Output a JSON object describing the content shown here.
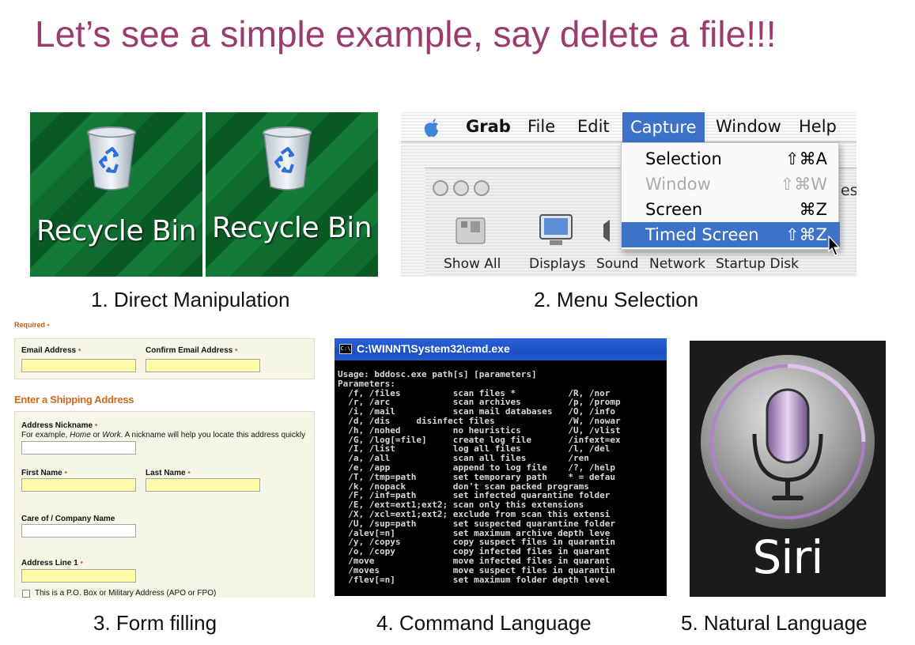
{
  "title": "Let’s see a simple example, say delete a file!!!",
  "captions": {
    "c1": "1. Direct Manipulation",
    "c2": "2. Menu Selection",
    "c3": "3. Form filling",
    "c4": "4. Command Language",
    "c5": "5. Natural Language"
  },
  "recycle": {
    "label": "Recycle Bin",
    "icon": "recycle-bin-icon",
    "bg_color": "#0f6b2f"
  },
  "mac": {
    "menus": [
      "Grab",
      "File",
      "Edit",
      "Capture",
      "Window",
      "Help"
    ],
    "active_menu": "Capture",
    "accent": "#3c73c9",
    "dropdown": [
      {
        "label": "Selection",
        "shortcut": "⇧⌘A"
      },
      {
        "label": "Window",
        "shortcut": "⇧⌘W"
      },
      {
        "label": "Screen",
        "shortcut": "⌘Z"
      },
      {
        "label": "Timed Screen",
        "shortcut": "⇧⌘Z"
      }
    ],
    "prefs": [
      "Show All",
      "Displays",
      "Sound",
      "Network",
      "Startup Disk"
    ],
    "partial": "es"
  },
  "form": {
    "required": "Required",
    "email": "Email Address",
    "confirm_email": "Confirm Email Address",
    "ship_heading": "Enter a Shipping Address",
    "nickname": "Address Nickname",
    "nickname_help_1": "For example, ",
    "nickname_help_home": "Home",
    "nickname_help_or": " or ",
    "nickname_help_work": "Work",
    "nickname_help_2": ". A nickname will help you locate this address quickly",
    "first_name": "First Name",
    "last_name": "Last Name",
    "care_of": "Care of / Company Name",
    "address1": "Address Line 1",
    "po_box": "This is a P.O. Box or Military Address (APO or FPO)",
    "star": "•"
  },
  "cmd": {
    "title": "C:\\WINNT\\System32\\cmd.exe",
    "icon": "C:\\",
    "text": "Usage: bddosc.exe path[s] [parameters]\nParameters:\n  /f, /files          scan files *          /R, /nor\n  /r, /arc            scan archives         /p, /promp\n  /i, /mail           scan mail databases   /O, /info\n  /d, /dis     disinfect files              /W, /nowar\n  /h, /nohed          no heuristics         /U, /vlist\n  /G, /log[=file]     create log file       /infext=ex\n  /I, /list           log all files         /l, /del\n  /a, /all            scan all files        /ren\n  /e, /app            append to log file    /?, /help\n  /T, /tmp=path       set temporary path    * = defau\n  /k, /nopack         don't scan packed programs\n  /F, /inf=path       set infected quarantine folder\n  /E, /ext=ext1;ext2; scan only this extensions\n  /X, /xcl=ext1;ext2; exclude from scan this extensi\n  /U, /sup=path       set suspected quarantine folder\n  /alev[=n]           set maximum archive depth leve\n  /y, /copys          copy suspect files in quarantin\n  /o, /copy           copy infected files in quarant\n  /move               move infected files in quarant\n  /moves              move suspect files in quarantin\n  /flev[=n]           set maximum folder depth level"
  },
  "siri": {
    "label": "Siri",
    "icon": "microphone-icon",
    "ring_color": "#b57cd6"
  }
}
